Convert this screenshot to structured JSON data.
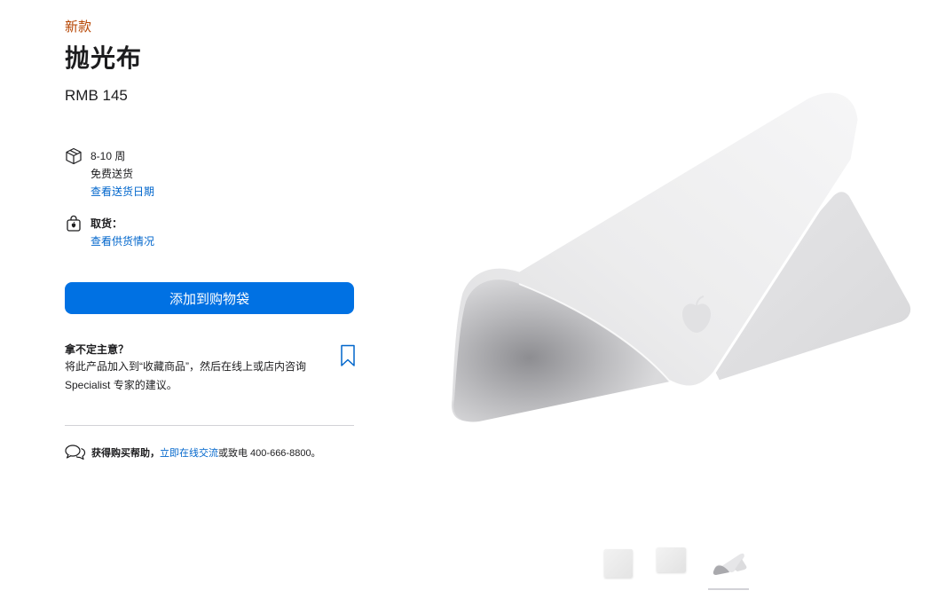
{
  "product": {
    "badge": "新款",
    "title": "抛光布",
    "price": "RMB 145"
  },
  "delivery": {
    "icon": "box-icon",
    "time": "8-10 周",
    "shipping": "免费送货",
    "link": "查看送货日期"
  },
  "pickup": {
    "icon": "store-bag-icon",
    "label": "取货：",
    "link": "查看供货情况"
  },
  "cta": {
    "add_to_bag": "添加到购物袋"
  },
  "undecided": {
    "title": "拿不定主意？",
    "body": "将此产品加入到“收藏商品”，然后在线上或店内咨询 Specialist 专家的建议。",
    "icon": "bookmark-icon"
  },
  "help": {
    "icon": "chat-bubbles-icon",
    "label": "获得购买帮助，",
    "link": "立即在线交流",
    "rest": " 或致电 400-666-8800。"
  },
  "gallery": {
    "thumbnails": [
      "thumbnail-1",
      "thumbnail-2",
      "thumbnail-3"
    ],
    "selected_index": 3
  }
}
